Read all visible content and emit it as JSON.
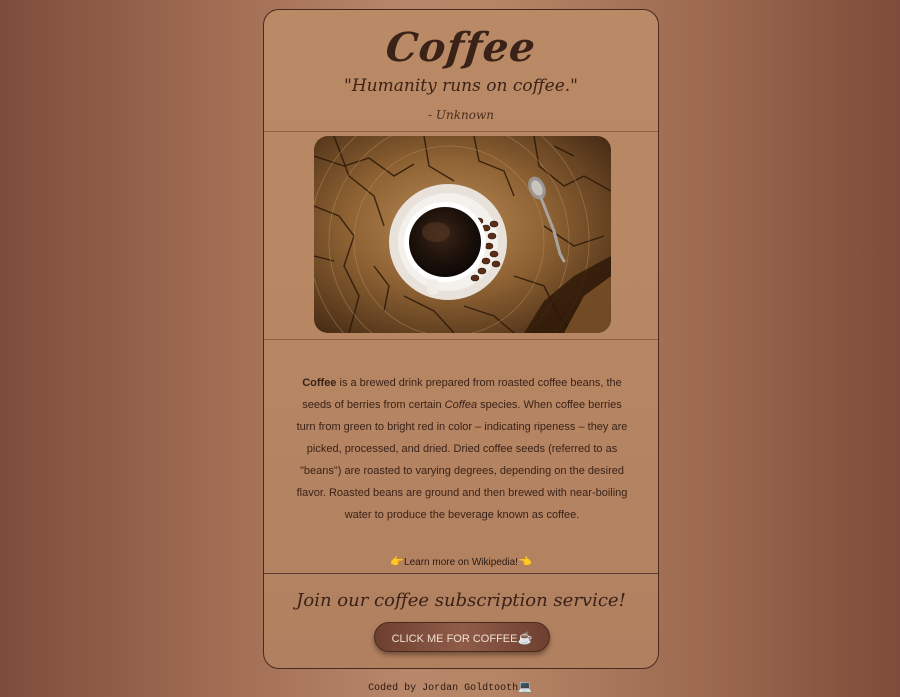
{
  "header": {
    "title": "Coffee",
    "quote": "\"Humanity runs on coffee.\"",
    "author": "- Unknown"
  },
  "image": {
    "alt": "Cup of black coffee on saucer with coffee beans and a spoon on a cracked wooden stump"
  },
  "description": {
    "term": "Coffee",
    "part1": " is a brewed drink prepared from roasted coffee beans, the seeds of berries from certain ",
    "genus": "Coffea",
    "part2": " species. When coffee berries turn from green to bright red in color – indicating ripeness – they are picked, processed, and dried. Dried coffee seeds (referred to as \"beans\") are roasted to varying degrees, depending on the desired flavor. Roasted beans are ground and then brewed with near-boiling water to produce the beverage known as coffee."
  },
  "learn_more": {
    "left_icon": "👉",
    "label": "Learn more on Wikipedia!",
    "right_icon": "👈"
  },
  "subscription": {
    "heading": "Join our coffee subscription service!",
    "button_label": "CLICK ME FOR COFFEE",
    "button_icon": "☕"
  },
  "footer": {
    "text": "Coded by Jordan Goldtooth",
    "icon": "💻"
  },
  "colors": {
    "text_dark": "#3b2218",
    "button": "#8f5c48",
    "card": "#b98a65"
  }
}
